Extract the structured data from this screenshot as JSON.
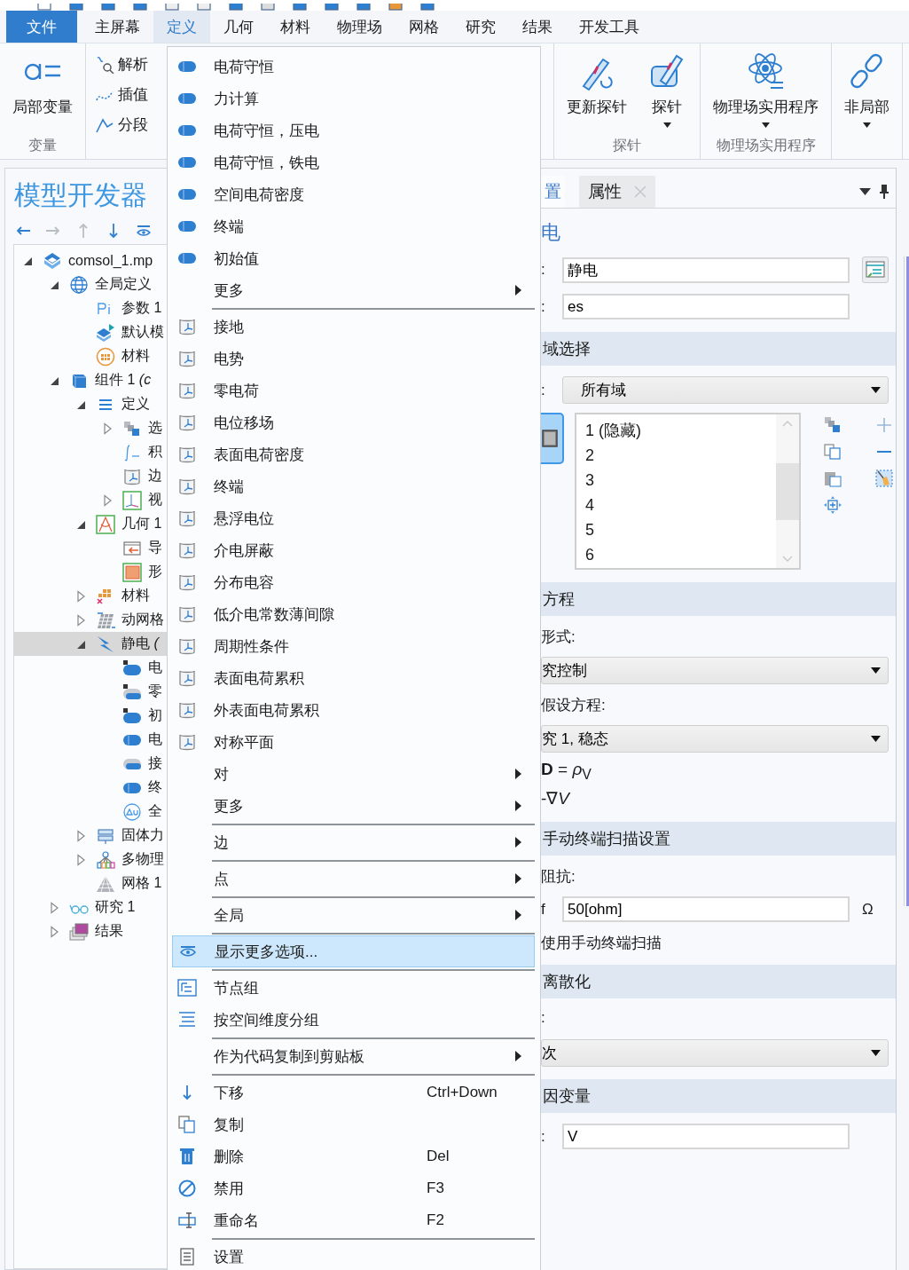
{
  "menubar": [
    {
      "label": "文件",
      "kind": "file",
      "selected": false
    },
    {
      "label": "主屏幕",
      "kind": "tab",
      "selected": false
    },
    {
      "label": "定义",
      "kind": "tab",
      "selected": true
    },
    {
      "label": "几何",
      "kind": "tab",
      "selected": false
    },
    {
      "label": "材料",
      "kind": "tab",
      "selected": false
    },
    {
      "label": "物理场",
      "kind": "tab",
      "selected": false
    },
    {
      "label": "网格",
      "kind": "tab",
      "selected": false
    },
    {
      "label": "研究",
      "kind": "tab",
      "selected": false
    },
    {
      "label": "结果",
      "kind": "tab",
      "selected": false
    },
    {
      "label": "开发工具",
      "kind": "tab",
      "selected": false
    }
  ],
  "ribbon": {
    "left": [
      {
        "kind": "large",
        "label": "变量",
        "buttons": [
          {
            "label": "局部变量",
            "kind": "variables",
            "dropdown": false
          }
        ]
      },
      {
        "kind": "small",
        "buttons": [
          {
            "label": "解析",
            "kind": "function"
          },
          {
            "label": "插值",
            "kind": "interpolation"
          },
          {
            "label": "分段",
            "kind": "piecewise"
          }
        ]
      }
    ],
    "right": [
      {
        "kind": "large",
        "label": "探针",
        "buttons": [
          {
            "label": "更新探针",
            "kind": "probe-update",
            "dropdown": false
          },
          {
            "label": "探针",
            "kind": "probe",
            "dropdown": true
          }
        ]
      },
      {
        "kind": "large",
        "label": "物理场实用程序",
        "buttons": [
          {
            "label": "物理场实用程序",
            "kind": "atom",
            "dropdown": true
          }
        ]
      },
      {
        "kind": "large",
        "buttons": [
          {
            "label": "非局部",
            "kind": "link",
            "dropdown": true
          }
        ]
      }
    ]
  },
  "model_builder": {
    "title": "模型开发器",
    "toolbar": [
      {
        "kind": "back",
        "disabled": false
      },
      {
        "kind": "forward",
        "disabled": true
      },
      {
        "kind": "up",
        "disabled": true
      },
      {
        "kind": "down",
        "disabled": false
      },
      {
        "kind": "show",
        "disabled": false
      }
    ],
    "tree": [
      {
        "label": "comsol_1.mp",
        "kind": "model",
        "expanded": true,
        "selected": false,
        "children": [
          {
            "label": "全局定义",
            "kind": "globe",
            "expanded": true,
            "selected": false,
            "children": [
              {
                "label": "参数 1",
                "kind": "param",
                "selected": false
              },
              {
                "label": "默认模",
                "kind": "default-model",
                "selected": false
              },
              {
                "label": "材料",
                "kind": "material",
                "selected": false
              }
            ]
          },
          {
            "label": "组件 1 *(c*",
            "kind": "component",
            "expanded": true,
            "selected": false,
            "children": [
              {
                "label": "定义",
                "kind": "definitions",
                "expanded": true,
                "selected": false,
                "children": [
                  {
                    "label": "选",
                    "kind": "selection",
                    "expanded": false,
                    "selected": false
                  },
                  {
                    "label": "积",
                    "kind": "integral",
                    "selected": false
                  },
                  {
                    "label": "边",
                    "kind": "boundary",
                    "selected": false
                  },
                  {
                    "label": "视",
                    "kind": "view",
                    "expanded": false,
                    "selected": false
                  }
                ]
              },
              {
                "label": "几何 1",
                "kind": "geometry",
                "expanded": true,
                "selected": false,
                "children": [
                  {
                    "label": "导",
                    "kind": "import",
                    "selected": false
                  },
                  {
                    "label": "形",
                    "kind": "shape",
                    "selected": false
                  }
                ]
              },
              {
                "label": "材料",
                "kind": "materials",
                "expanded": false,
                "selected": false
              },
              {
                "label": "动网格",
                "kind": "moving-mesh",
                "expanded": false,
                "selected": false
              },
              {
                "label": "静电 *(*",
                "kind": "electrostatics",
                "expanded": true,
                "selected": true,
                "children": [
                  {
                    "label": "电",
                    "kind": "feature-default",
                    "selected": false
                  },
                  {
                    "label": "零",
                    "kind": "feature-default-boundary",
                    "selected": false
                  },
                  {
                    "label": "初",
                    "kind": "feature-default",
                    "selected": false
                  },
                  {
                    "label": "电",
                    "kind": "feature",
                    "selected": false
                  },
                  {
                    "label": "接",
                    "kind": "feature-boundary",
                    "selected": false
                  },
                  {
                    "label": "终",
                    "kind": "feature",
                    "selected": false
                  },
                  {
                    "label": "全",
                    "kind": "global-equation",
                    "selected": false
                  }
                ]
              },
              {
                "label": "固体力",
                "kind": "solid",
                "expanded": false,
                "selected": false
              },
              {
                "label": "多物理",
                "kind": "multiphysics",
                "expanded": false,
                "selected": false
              },
              {
                "label": "网格 1",
                "kind": "mesh",
                "selected": false
              }
            ]
          },
          {
            "label": "研究 1",
            "kind": "study",
            "expanded": false,
            "selected": false
          },
          {
            "label": "结果",
            "kind": "results",
            "expanded": false,
            "selected": false
          }
        ]
      }
    ]
  },
  "context_menu": [
    {
      "kind": "domain",
      "label": "电荷守恒",
      "selected": false
    },
    {
      "kind": "domain",
      "label": "力计算",
      "selected": false
    },
    {
      "kind": "domain",
      "label": "电荷守恒，压电",
      "selected": false
    },
    {
      "kind": "domain",
      "label": "电荷守恒，铁电",
      "selected": false
    },
    {
      "kind": "domain",
      "label": "空间电荷密度",
      "selected": false
    },
    {
      "kind": "domain",
      "label": "终端",
      "selected": false
    },
    {
      "kind": "domain",
      "label": "初始值",
      "selected": false
    },
    {
      "kind": "submenu",
      "label": "更多",
      "selected": false
    },
    {
      "kind": "separator"
    },
    {
      "kind": "boundary",
      "label": "接地",
      "selected": false
    },
    {
      "kind": "boundary",
      "label": "电势",
      "selected": false
    },
    {
      "kind": "boundary",
      "label": "零电荷",
      "selected": false
    },
    {
      "kind": "boundary",
      "label": "电位移场",
      "selected": false
    },
    {
      "kind": "boundary",
      "label": "表面电荷密度",
      "selected": false
    },
    {
      "kind": "boundary",
      "label": "终端",
      "selected": false
    },
    {
      "kind": "boundary",
      "label": "悬浮电位",
      "selected": false
    },
    {
      "kind": "boundary",
      "label": "介电屏蔽",
      "selected": false
    },
    {
      "kind": "boundary",
      "label": "分布电容",
      "selected": false
    },
    {
      "kind": "boundary",
      "label": "低介电常数薄间隙",
      "selected": false
    },
    {
      "kind": "boundary",
      "label": "周期性条件",
      "selected": false
    },
    {
      "kind": "boundary",
      "label": "表面电荷累积",
      "selected": false
    },
    {
      "kind": "boundary",
      "label": "外表面电荷累积",
      "selected": false
    },
    {
      "kind": "boundary",
      "label": "对称平面",
      "selected": false
    },
    {
      "kind": "submenu",
      "label": "对",
      "selected": false
    },
    {
      "kind": "submenu",
      "label": "更多",
      "selected": false
    },
    {
      "kind": "separator"
    },
    {
      "kind": "submenu",
      "label": "边",
      "selected": false
    },
    {
      "kind": "separator"
    },
    {
      "kind": "submenu",
      "label": "点",
      "selected": false
    },
    {
      "kind": "separator"
    },
    {
      "kind": "submenu",
      "label": "全局",
      "selected": false
    },
    {
      "kind": "separator"
    },
    {
      "kind": "show",
      "label": "显示更多选项...",
      "selected": true
    },
    {
      "kind": "separator"
    },
    {
      "kind": "node-group",
      "label": "节点组",
      "selected": false
    },
    {
      "kind": "group-dimension",
      "label": "按空间维度分组",
      "selected": false
    },
    {
      "kind": "separator"
    },
    {
      "kind": "submenu",
      "label": "作为代码复制到剪贴板",
      "selected": false
    },
    {
      "kind": "separator"
    },
    {
      "kind": "move-down",
      "label": "下移",
      "shortcut": "Ctrl+Down",
      "selected": false
    },
    {
      "kind": "copy",
      "label": "复制",
      "selected": false
    },
    {
      "kind": "delete",
      "label": "删除",
      "shortcut": "Del",
      "selected": false
    },
    {
      "kind": "disable",
      "label": "禁用",
      "shortcut": "F3",
      "selected": false
    },
    {
      "kind": "rename",
      "label": "重命名",
      "shortcut": "F2",
      "selected": false
    },
    {
      "kind": "separator"
    },
    {
      "kind": "settings",
      "label": "设置",
      "selected": false
    }
  ],
  "properties": {
    "tabs": [
      {
        "label": "置",
        "selected": true,
        "closable": false
      },
      {
        "label": "属性",
        "selected": false,
        "closable": true
      }
    ],
    "title": "电",
    "rows": [
      {
        "kind": "field",
        "label": ":",
        "value": "静电",
        "action": true
      },
      {
        "kind": "field",
        "label": ":",
        "value": "es",
        "action": false
      },
      {
        "kind": "section",
        "label": "域选择"
      },
      {
        "kind": "dropdown",
        "label": ":",
        "value": "所有域"
      },
      {
        "kind": "selection",
        "items": [
          "1 (隐藏)",
          "2",
          "3",
          "4",
          "5",
          "6"
        ]
      },
      {
        "kind": "section",
        "label": "方程"
      },
      {
        "kind": "text",
        "label": "形式:"
      },
      {
        "kind": "dropdown",
        "value": "究控制"
      },
      {
        "kind": "text",
        "label": "假设方程:"
      },
      {
        "kind": "dropdown",
        "value": "究 1, 稳态"
      },
      {
        "kind": "equation",
        "label": "**D** = *ρ*$_{V}$"
      },
      {
        "kind": "equation",
        "label": "-∇*V*"
      },
      {
        "kind": "section",
        "label": "手动终端扫描设置"
      },
      {
        "kind": "text",
        "label": "阻抗:"
      },
      {
        "kind": "field",
        "label": "f",
        "value": "50[ohm]",
        "unit": "Ω",
        "action": false
      },
      {
        "kind": "text",
        "label": "使用手动终端扫描"
      },
      {
        "kind": "section",
        "label": "离散化"
      },
      {
        "kind": "text",
        "label": ":"
      },
      {
        "kind": "dropdown",
        "value": "次"
      },
      {
        "kind": "section",
        "label": "因变量"
      },
      {
        "kind": "field",
        "label": ":",
        "value": "V",
        "action": false
      }
    ]
  }
}
